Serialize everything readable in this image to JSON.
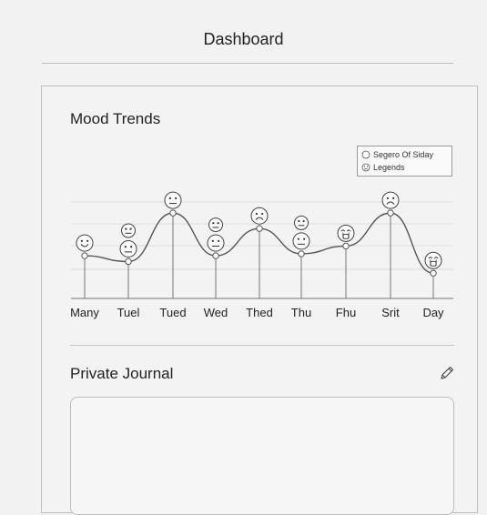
{
  "header": {
    "title": "Dashboard"
  },
  "mood_trends": {
    "title": "Mood Trends",
    "legend": [
      {
        "label": "Segero Of Siday",
        "icon": "circle-icon"
      },
      {
        "label": "Legends",
        "icon": "sad-face-icon"
      }
    ]
  },
  "chart_data": {
    "type": "line",
    "categories": [
      "Many",
      "Tuel",
      "Tued",
      "Wed",
      "Thed",
      "Thu",
      "Fhu",
      "Srit",
      "Day"
    ],
    "series": [
      {
        "values": [
          2.2,
          1.9,
          4.4,
          2.2,
          3.6,
          2.3,
          2.7,
          4.4,
          1.3
        ]
      }
    ],
    "ylim": [
      0,
      6
    ],
    "grid": true,
    "legend_position": "top-right",
    "face_icons": [
      [
        "smile"
      ],
      [
        "neutral",
        "neutral"
      ],
      [
        "neutral"
      ],
      [
        "neutral",
        "neutral"
      ],
      [
        "sad"
      ],
      [
        "neutral",
        "neutral"
      ],
      [
        "crying"
      ],
      [
        "sad"
      ],
      [
        "crying"
      ]
    ],
    "colors": {
      "line": "#555555",
      "grid": "#dddddd",
      "axis": "#777777"
    }
  },
  "journal": {
    "title": "Private Journal",
    "edit_icon": "pencil-icon",
    "entry_value": ""
  }
}
